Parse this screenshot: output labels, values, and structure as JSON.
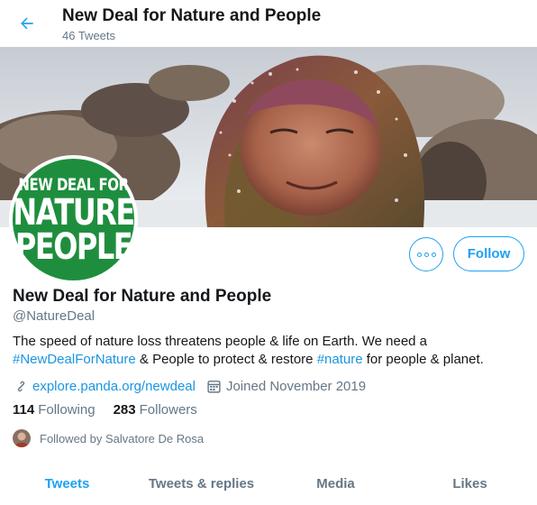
{
  "header": {
    "title": "New Deal for Nature and People",
    "subtitle": "46 Tweets"
  },
  "avatar": {
    "line1": "NEW DEAL FOR",
    "line2": "NATURE",
    "line3": "PEOPLE",
    "color": "#1e8e3e"
  },
  "actions": {
    "follow_label": "Follow"
  },
  "profile": {
    "name": "New Deal for Nature and People",
    "handle": "@NatureDeal",
    "bio_part1": "The speed of nature loss threatens people & life on Earth. We need a ",
    "bio_tag1": "#NewDealForNature",
    "bio_part2": " & People to protect & restore ",
    "bio_tag2": "#nature",
    "bio_part3": " for people & planet.",
    "website": "explore.panda.org/newdeal",
    "joined": "Joined November 2019"
  },
  "stats": {
    "following_count": "114",
    "following_label": "Following",
    "followers_count": "283",
    "followers_label": "Followers"
  },
  "followed_by": "Followed by Salvatore De Rosa",
  "tabs": [
    {
      "label": "Tweets"
    },
    {
      "label": "Tweets & replies"
    },
    {
      "label": "Media"
    },
    {
      "label": "Likes"
    }
  ],
  "colors": {
    "accent": "#1da1f2",
    "link": "#1b95e0",
    "secondary_text": "#657786"
  },
  "icons": {
    "back": "arrow-left-icon",
    "more": "more-dots-icon",
    "website": "link-icon",
    "joined": "calendar-icon"
  }
}
